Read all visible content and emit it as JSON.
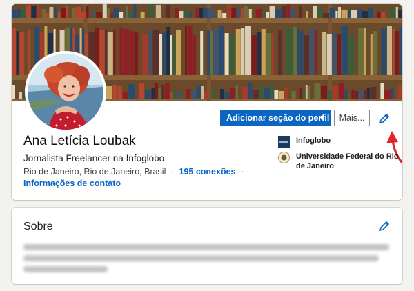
{
  "profile": {
    "name": "Ana Letícia Loubak",
    "headline": "Jornalista Freelancer na Infoglobo",
    "location": "Rio de Janeiro, Rio de Janeiro, Brasil",
    "connections": "195 conexões",
    "contact_info": "Informações de contato",
    "add_section_button": "Adicionar seção do perfil",
    "more_button": "Mais...",
    "current_company": "Infoglobo",
    "education": "Universidade Federal do Rio de Janeiro",
    "company_logo_text": "INFOGLOBO"
  },
  "about": {
    "title": "Sobre",
    "text": ""
  },
  "icons": {
    "edit": "pencil-icon",
    "dropdown": "caret-down-icon",
    "annotation": "red-arrow-icon"
  },
  "colors": {
    "accent": "#0a66c2",
    "annotation": "#e0252b",
    "background": "#f3f2ef"
  }
}
